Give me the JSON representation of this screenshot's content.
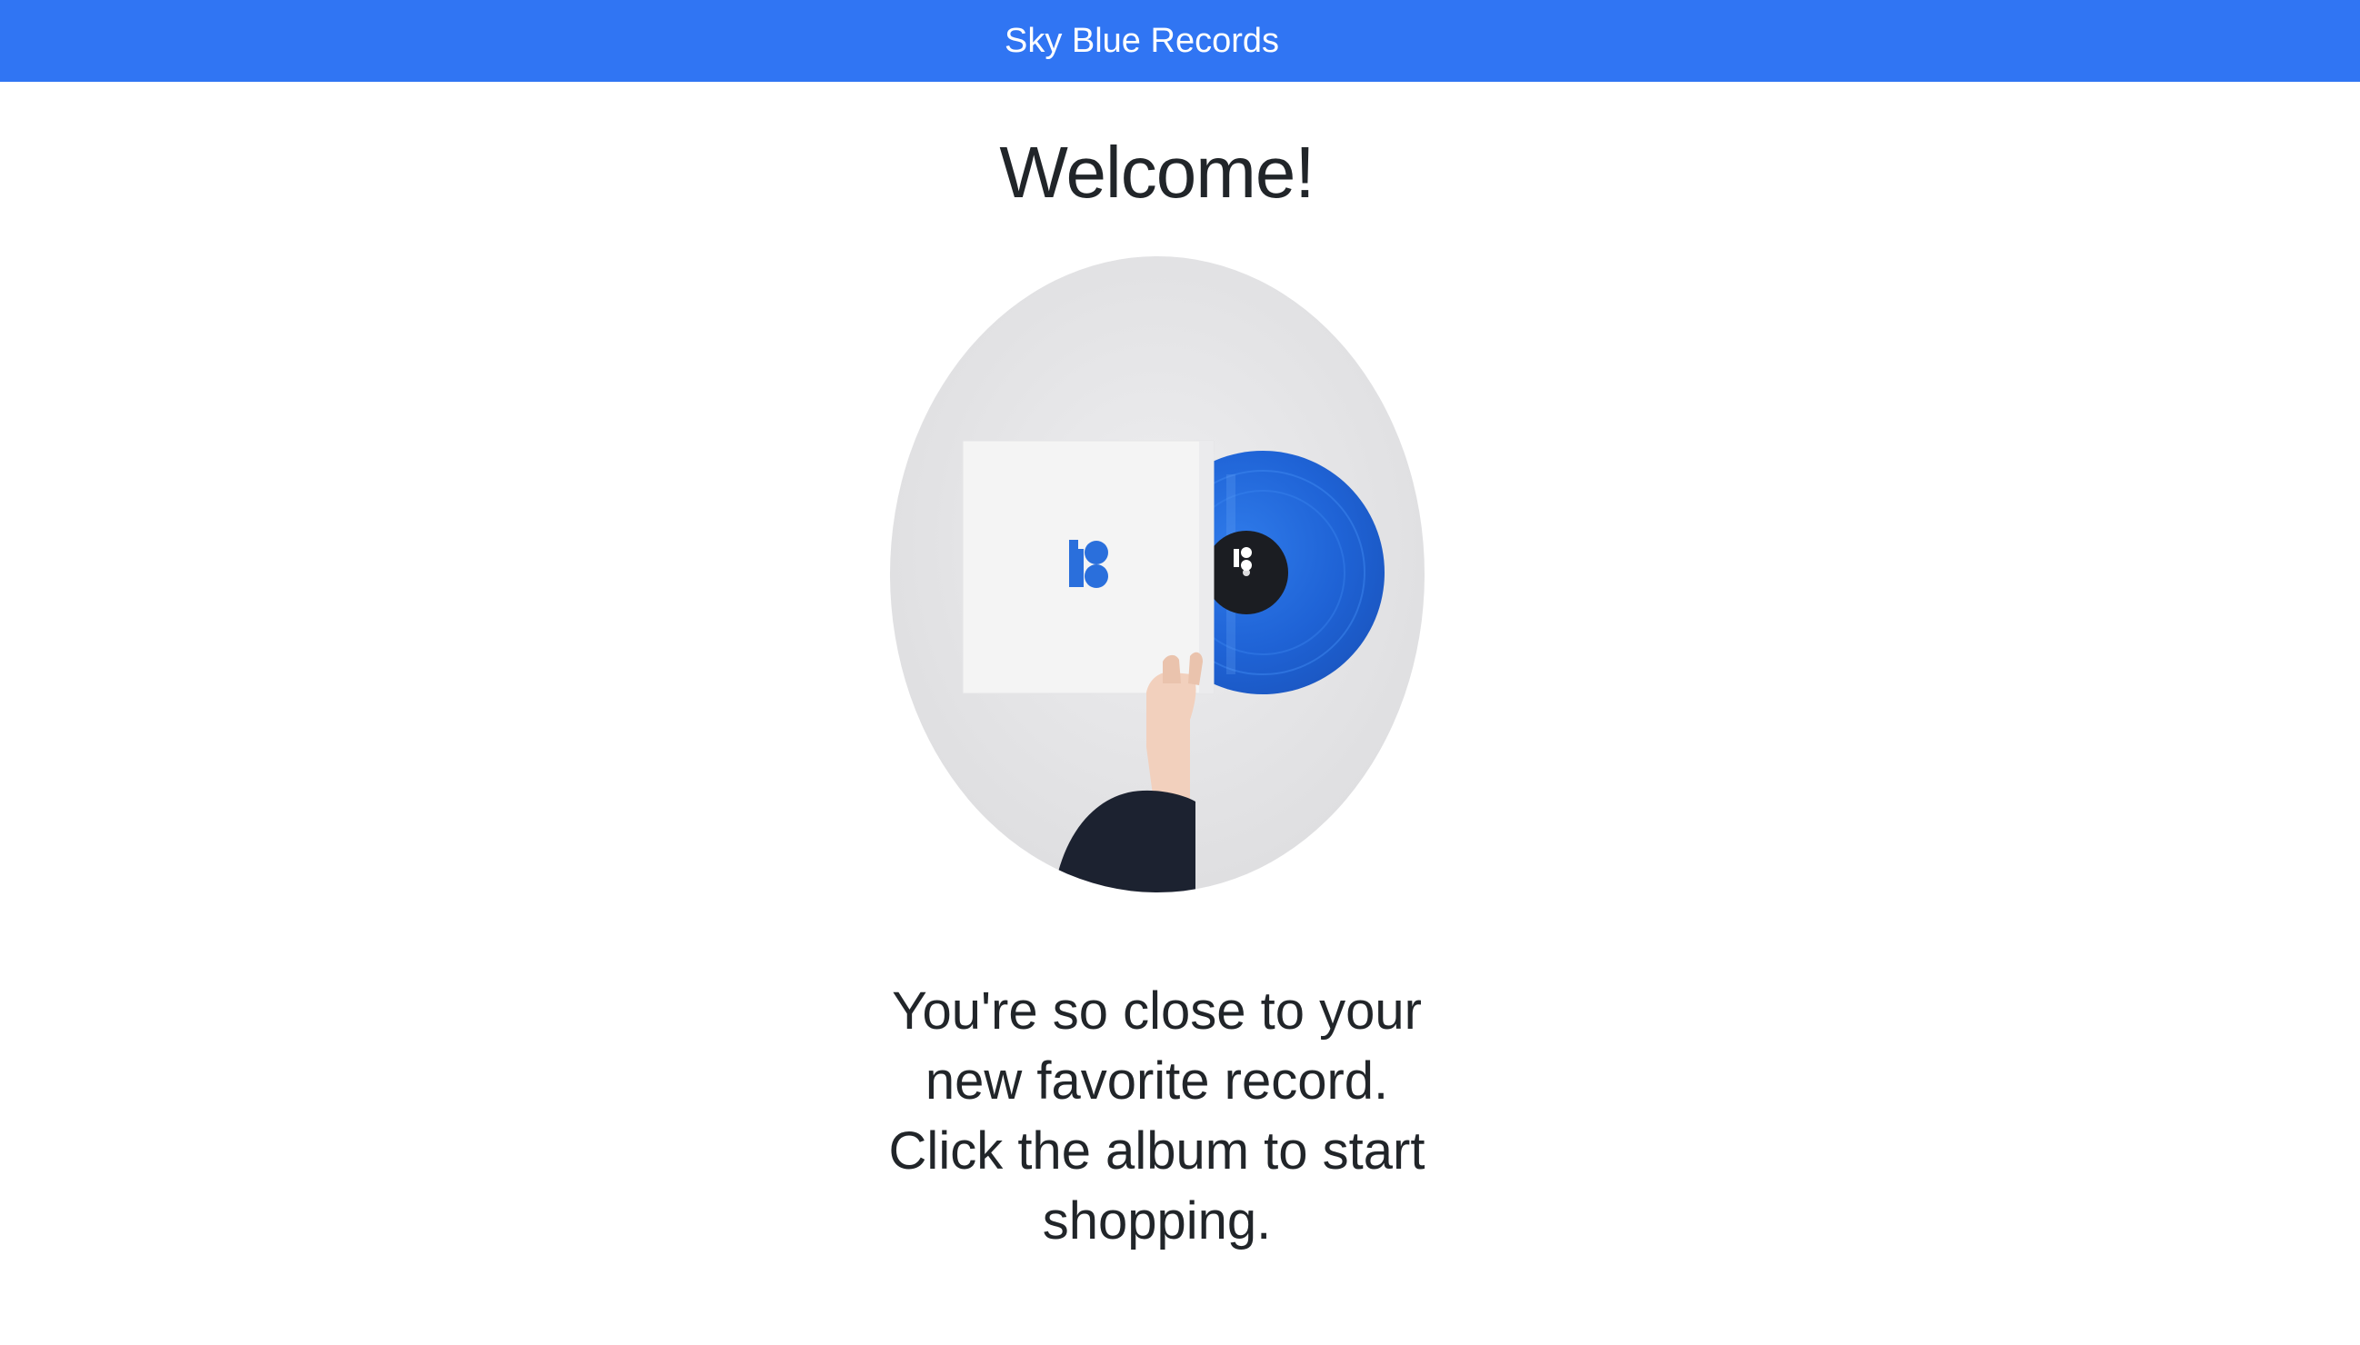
{
  "navbar": {
    "brand": "Sky Blue Records"
  },
  "main": {
    "heading": "Welcome!",
    "album_image_alt": "Hand holding a white album sleeve with a blue vinyl record",
    "tagline_lines": [
      "You're so close to your",
      "new favorite record.",
      "Click the album to start",
      "shopping."
    ]
  },
  "colors": {
    "navbar_bg": "#3075f3",
    "vinyl_blue": "#1f63d6",
    "sleeve": "#f4f4f4"
  }
}
